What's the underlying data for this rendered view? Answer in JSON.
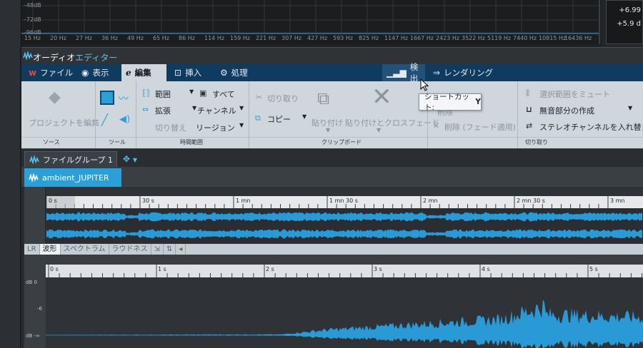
{
  "spectrum": {
    "db_labels": [
      "-48dB",
      "-72dB",
      "-96dB"
    ],
    "freq_labels": [
      "15 Hz",
      "20 Hz",
      "27 Hz",
      "36 Hz",
      "49 Hz",
      "65 Hz",
      "86 Hz",
      "114 Hz",
      "159 Hz",
      "221 Hz",
      "307 Hz",
      "427 Hz",
      "593 Hz",
      "825 Hz",
      "1147 Hz",
      "1667 Hz",
      "2423 Hz",
      "3522 Hz",
      "5119 Hz",
      "7440 Hz",
      "10815 Hz",
      "16436 Hz"
    ],
    "right_values": [
      "+6.99",
      "+5.9 d"
    ]
  },
  "editor": {
    "title_plain": "オーディオ",
    "title_accent": "エディター"
  },
  "menu": {
    "file": "ファイル",
    "view": "表示",
    "edit": "編集",
    "insert": "挿入",
    "process": "処理",
    "analyze": "検出",
    "render": "レンダリング"
  },
  "ribbon": {
    "project_edit": "プロジェクトを編集",
    "source": "ソース",
    "tools": "ツール",
    "range": "範囲",
    "all": "すべて",
    "expand": "拡張",
    "channel": "チャンネル",
    "toggle": "切り替え",
    "region": "リージョン",
    "time_range": "時間範囲",
    "cut": "切り取り",
    "copy": "コピー",
    "paste": "貼り付け",
    "paste_crossfade": "貼り付けとクロスフェード",
    "clipboard": "クリップボード",
    "delete": "削除",
    "delete_fade": "削除 (フェード適用)",
    "mute_selection": "選択範囲をミュート",
    "create_silence": "無音部分の作成",
    "swap_stereo": "ステレオチャンネルを入れ替え",
    "cut_group": "切り取り"
  },
  "tooltip": {
    "label": "ショートカット:",
    "key": "Y"
  },
  "files": {
    "group_tab": "ファイルグループ 1",
    "file_tab": "ambient_JUPITER"
  },
  "overview": {
    "ticks": [
      "0 s",
      "30 s",
      "1 mn",
      "1 mn 30 s",
      "2 mn",
      "2 mn 30 s",
      "3 mn"
    ]
  },
  "view_tabs": {
    "lr": "LR",
    "waveform": "波形",
    "spectrum": "スペクトラム",
    "loudness": "ラウドネス"
  },
  "main": {
    "ticks": [
      "0 s",
      "1 s",
      "2 s",
      "3 s",
      "4 s",
      "5 s"
    ],
    "db_labels": [
      "dB 0",
      "-6",
      "dB -∞"
    ]
  },
  "colors": {
    "accent": "#2ba0d8",
    "menu_bg": "#0f3b61",
    "ribbon_bg": "#cfd6dc",
    "wave": "#2a9ad6"
  }
}
